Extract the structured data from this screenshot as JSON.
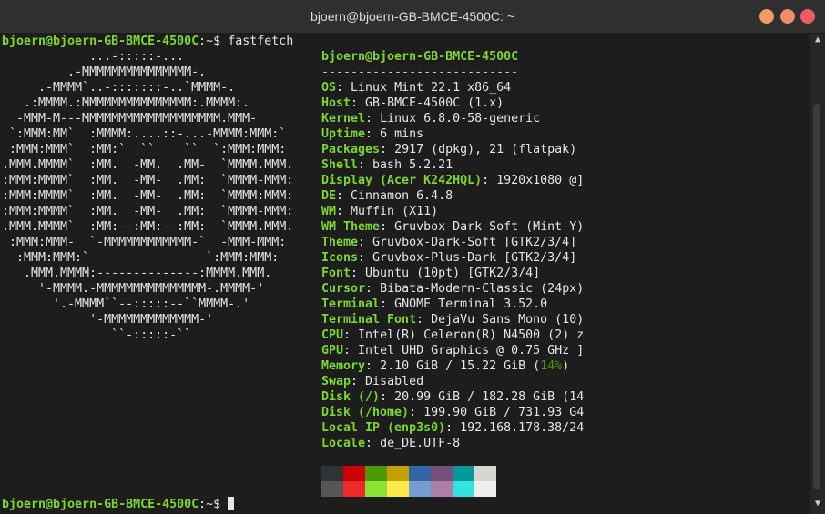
{
  "window": {
    "title": "bjoern@bjoern-GB-BMCE-4500C: ~"
  },
  "prompt": {
    "user_host": "bjoern@bjoern-GB-BMCE-4500C",
    "path": ":~$ ",
    "command": "fastfetch"
  },
  "logo_lines": [
    "            ...-:::::-...",
    "         .-MMMMMMMMMMMMMMM-.",
    "     .-MMMM`..-:::::::-..`MMMM-.",
    "   .:MMMM.:MMMMMMMMMMMMMMM:.MMMM:.",
    "  -MMM-M---MMMMMMMMMMMMMMMMMMM.MMM-",
    " `:MMM:MM`  :MMMM:....::-...-MMMM:MMM:`",
    " :MMM:MMM`  :MM:`  ``    ``  `:MMM:MMM:",
    ".MMM.MMMM`  :MM.  -MM.  .MM-  `MMMM.MMM.",
    ":MMM:MMMM`  :MM.  -MM-  .MM:  `MMMM-MMM:",
    ":MMM:MMMM`  :MM.  -MM-  .MM:  `MMMM:MMM:",
    ":MMM:MMMM`  :MM.  -MM-  .MM:  `MMMM-MMM:",
    ".MMM.MMMM`  :MM:--:MM:--:MM:  `MMMM.MMM.",
    " :MMM:MMM-  `-MMMMMMMMMMMM-`  -MMM-MMM:",
    "  :MMM:MMM:`                `:MMM:MMM:",
    "   .MMM.MMMM:--------------:MMMM.MMM.",
    "     '-MMMM.-MMMMMMMMMMMMMMM-.MMMM-'",
    "       '.-MMMM``--:::::--``MMMM-.'",
    "            '-MMMMMMMMMMMMM-'",
    "               ``-:::::-``"
  ],
  "info": {
    "header": "bjoern@bjoern-GB-BMCE-4500C",
    "separator": "---------------------------",
    "rows": [
      {
        "k": "OS",
        "v": "Linux Mint 22.1 x86_64"
      },
      {
        "k": "Host",
        "v": "GB-BMCE-4500C (1.x)"
      },
      {
        "k": "Kernel",
        "v": "Linux 6.8.0-58-generic"
      },
      {
        "k": "Uptime",
        "v": "6 mins"
      },
      {
        "k": "Packages",
        "v": "2917 (dpkg), 21 (flatpak)"
      },
      {
        "k": "Shell",
        "v": "bash 5.2.21"
      },
      {
        "k": "Display (Acer K242HQL)",
        "v": "1920x1080 @]"
      },
      {
        "k": "DE",
        "v": "Cinnamon 6.4.8"
      },
      {
        "k": "WM",
        "v": "Muffin (X11)"
      },
      {
        "k": "WM Theme",
        "v": "Gruvbox-Dark-Soft (Mint-Y)"
      },
      {
        "k": "Theme",
        "v": "Gruvbox-Dark-Soft [GTK2/3/4]"
      },
      {
        "k": "Icons",
        "v": "Gruvbox-Plus-Dark [GTK2/3/4]"
      },
      {
        "k": "Font",
        "v": "Ubuntu (10pt) [GTK2/3/4]"
      },
      {
        "k": "Cursor",
        "v": "Bibata-Modern-Classic (24px)"
      },
      {
        "k": "Terminal",
        "v": "GNOME Terminal 3.52.0"
      },
      {
        "k": "Terminal Font",
        "v": "DejaVu Sans Mono (10)"
      },
      {
        "k": "CPU",
        "v": "Intel(R) Celeron(R) N4500 (2) z"
      },
      {
        "k": "GPU",
        "v": "Intel UHD Graphics @ 0.75 GHz ]"
      },
      {
        "k": "Memory",
        "v": "2.10 GiB / 15.22 GiB (",
        "pct": "14%",
        "tail": ")"
      },
      {
        "k": "Swap",
        "v": "Disabled"
      },
      {
        "k": "Disk (/)",
        "v": "20.99 GiB / 182.28 GiB (14"
      },
      {
        "k": "Disk (/home)",
        "v": "199.90 GiB / 731.93 G4"
      },
      {
        "k": "Local IP (enp3s0)",
        "v": "192.168.178.38/24"
      },
      {
        "k": "Locale",
        "v": "de_DE.UTF-8"
      }
    ]
  },
  "palette": {
    "top": [
      "#2e3436",
      "#cc0000",
      "#4e9a06",
      "#c4a000",
      "#3465a4",
      "#75507b",
      "#06989a",
      "#d3d7cf"
    ],
    "bottom": [
      "#555753",
      "#ef2929",
      "#8ae234",
      "#fce94f",
      "#729fcf",
      "#ad7fa8",
      "#34e2e2",
      "#eeeeec"
    ]
  },
  "colors": {
    "accent_green": "#7dd62e",
    "terminal_bg": "#1d1d1d",
    "titlebar_bg": "#2f2f2f"
  }
}
